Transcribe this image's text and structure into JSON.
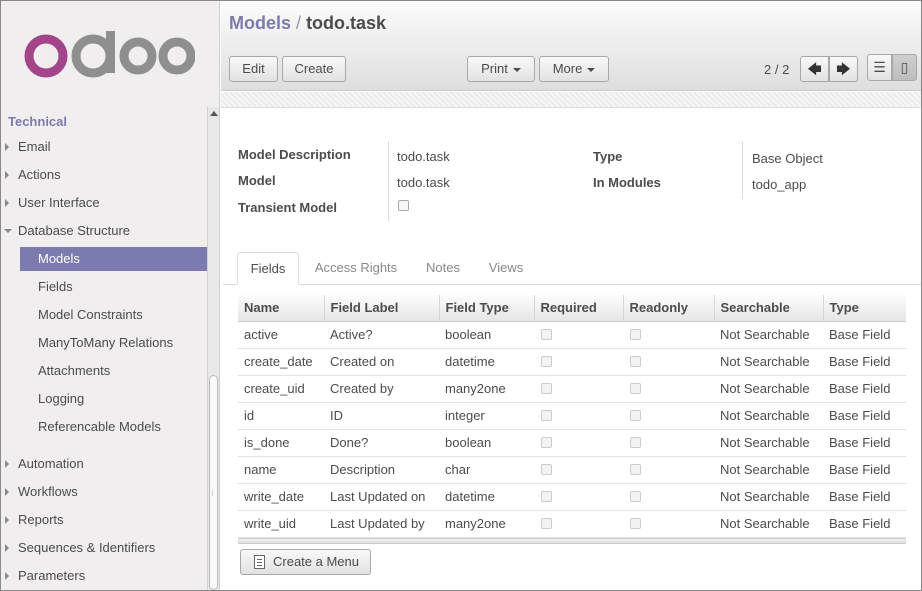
{
  "brand": {
    "logo_text": "odoo"
  },
  "sidebar": {
    "section_title": "Technical",
    "items": [
      {
        "label": "Email",
        "level": 0,
        "caret": "closed"
      },
      {
        "label": "Actions",
        "level": 0,
        "caret": "closed"
      },
      {
        "label": "User Interface",
        "level": 0,
        "caret": "closed"
      },
      {
        "label": "Database Structure",
        "level": 0,
        "caret": "open"
      },
      {
        "label": "Models",
        "level": 1,
        "active": true
      },
      {
        "label": "Fields",
        "level": 1
      },
      {
        "label": "Model Constraints",
        "level": 1
      },
      {
        "label": "ManyToMany Relations",
        "level": 1
      },
      {
        "label": "Attachments",
        "level": 1
      },
      {
        "label": "Logging",
        "level": 1
      },
      {
        "label": "Referencable Models",
        "level": 1
      },
      {
        "label": "Automation",
        "level": 0,
        "caret": "closed"
      },
      {
        "label": "Workflows",
        "level": 0,
        "caret": "closed"
      },
      {
        "label": "Reports",
        "level": 0,
        "caret": "closed"
      },
      {
        "label": "Sequences & Identifiers",
        "level": 0,
        "caret": "closed"
      },
      {
        "label": "Parameters",
        "level": 0,
        "caret": "closed"
      }
    ]
  },
  "breadcrumb": {
    "parent": "Models",
    "separator": "/",
    "current": "todo.task"
  },
  "toolbar": {
    "edit_label": "Edit",
    "create_label": "Create",
    "print_label": "Print",
    "more_label": "More",
    "pager_text": "2 / 2",
    "prev_icon": "arrow-left-icon",
    "next_icon": "arrow-right-icon",
    "list_view_icon": "list-view-icon",
    "form_view_icon": "form-view-icon"
  },
  "form": {
    "model_description_label": "Model Description",
    "model_description_value": "todo.task",
    "model_label": "Model",
    "model_value": "todo.task",
    "transient_label": "Transient Model",
    "transient_checked": false,
    "type_label": "Type",
    "type_value": "Base Object",
    "modules_label": "In Modules",
    "modules_value": "todo_app"
  },
  "tabs": [
    {
      "label": "Fields",
      "active": true
    },
    {
      "label": "Access Rights"
    },
    {
      "label": "Notes"
    },
    {
      "label": "Views"
    }
  ],
  "fields_table": {
    "columns": [
      "Name",
      "Field Label",
      "Field Type",
      "Required",
      "Readonly",
      "Searchable",
      "Type"
    ],
    "rows": [
      {
        "name": "active",
        "label": "Active?",
        "ftype": "boolean",
        "searchable": "Not Searchable",
        "type": "Base Field"
      },
      {
        "name": "create_date",
        "label": "Created on",
        "ftype": "datetime",
        "searchable": "Not Searchable",
        "type": "Base Field"
      },
      {
        "name": "create_uid",
        "label": "Created by",
        "ftype": "many2one",
        "searchable": "Not Searchable",
        "type": "Base Field"
      },
      {
        "name": "id",
        "label": "ID",
        "ftype": "integer",
        "searchable": "Not Searchable",
        "type": "Base Field"
      },
      {
        "name": "is_done",
        "label": "Done?",
        "ftype": "boolean",
        "searchable": "Not Searchable",
        "type": "Base Field"
      },
      {
        "name": "name",
        "label": "Description",
        "ftype": "char",
        "searchable": "Not Searchable",
        "type": "Base Field"
      },
      {
        "name": "write_date",
        "label": "Last Updated on",
        "ftype": "datetime",
        "searchable": "Not Searchable",
        "type": "Base Field"
      },
      {
        "name": "write_uid",
        "label": "Last Updated by",
        "ftype": "many2one",
        "searchable": "Not Searchable",
        "type": "Base Field"
      }
    ],
    "create_menu_label": "Create a Menu"
  },
  "colors": {
    "accent": "#7c7bad",
    "logo_o": "#a24689",
    "logo_rest": "#8f8f8f"
  }
}
